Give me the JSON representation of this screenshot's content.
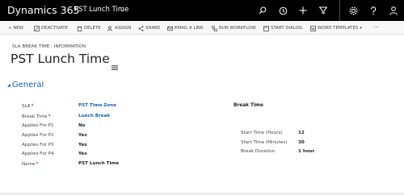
{
  "app": {
    "name": "Dynamics 365",
    "breadcrumb": "PST Lunch Time",
    "breadcrumb_chevron": "⌄"
  },
  "nav_icons": [
    "search-icon",
    "history-icon",
    "plus-icon",
    "filter-icon",
    "gear-icon",
    "help-icon",
    "user-icon"
  ],
  "commands": [
    {
      "label": "+ NEW",
      "icon": ""
    },
    {
      "label": "DEACTIVATE",
      "icon": "deactivate-icon"
    },
    {
      "label": "DELETE",
      "icon": "trash-icon"
    },
    {
      "label": "ASSIGN",
      "icon": "assign-icon"
    },
    {
      "label": "SHARE",
      "icon": "share-icon"
    },
    {
      "label": "EMAIL A LINK",
      "icon": "email-icon"
    },
    {
      "label": "RUN WORKFLOW",
      "icon": "workflow-icon"
    },
    {
      "label": "START DIALOG",
      "icon": "dialog-icon"
    },
    {
      "label": "WORD TEMPLATES",
      "icon": "word-icon"
    },
    {
      "label": "···",
      "icon": "more-icon"
    }
  ],
  "header": {
    "entity_label": "SLA BREAK TIME : INFORMATION",
    "title": "PST Lunch Time"
  },
  "section": {
    "label": "General"
  },
  "fields": {
    "sla": {
      "label": "SLA",
      "value": "PST Time Zone"
    },
    "break_time": {
      "label": "Break Time",
      "value": "Lunch Break"
    },
    "applies_p1": {
      "label": "Applies For P1",
      "value": "No"
    },
    "applies_p2": {
      "label": "Applies For P2",
      "value": "Yes"
    },
    "applies_p3": {
      "label": "Applies For P3",
      "value": "Yes"
    },
    "applies_p4": {
      "label": "Applies For P4",
      "value": "Yes"
    },
    "name": {
      "label": "Name",
      "value": "PST Lunch Time"
    }
  },
  "break_section": {
    "heading": "Break Time",
    "start_hours": {
      "label": "Start Time (Hours)",
      "value": "12"
    },
    "start_minutes": {
      "label": "Start Time (Minutes)",
      "value": "30"
    },
    "duration": {
      "label": "Break Duration",
      "value": "1 hour"
    }
  },
  "colors": {
    "nav_bg": "#000000",
    "accent": "#1160b7",
    "required": "#e00000"
  }
}
